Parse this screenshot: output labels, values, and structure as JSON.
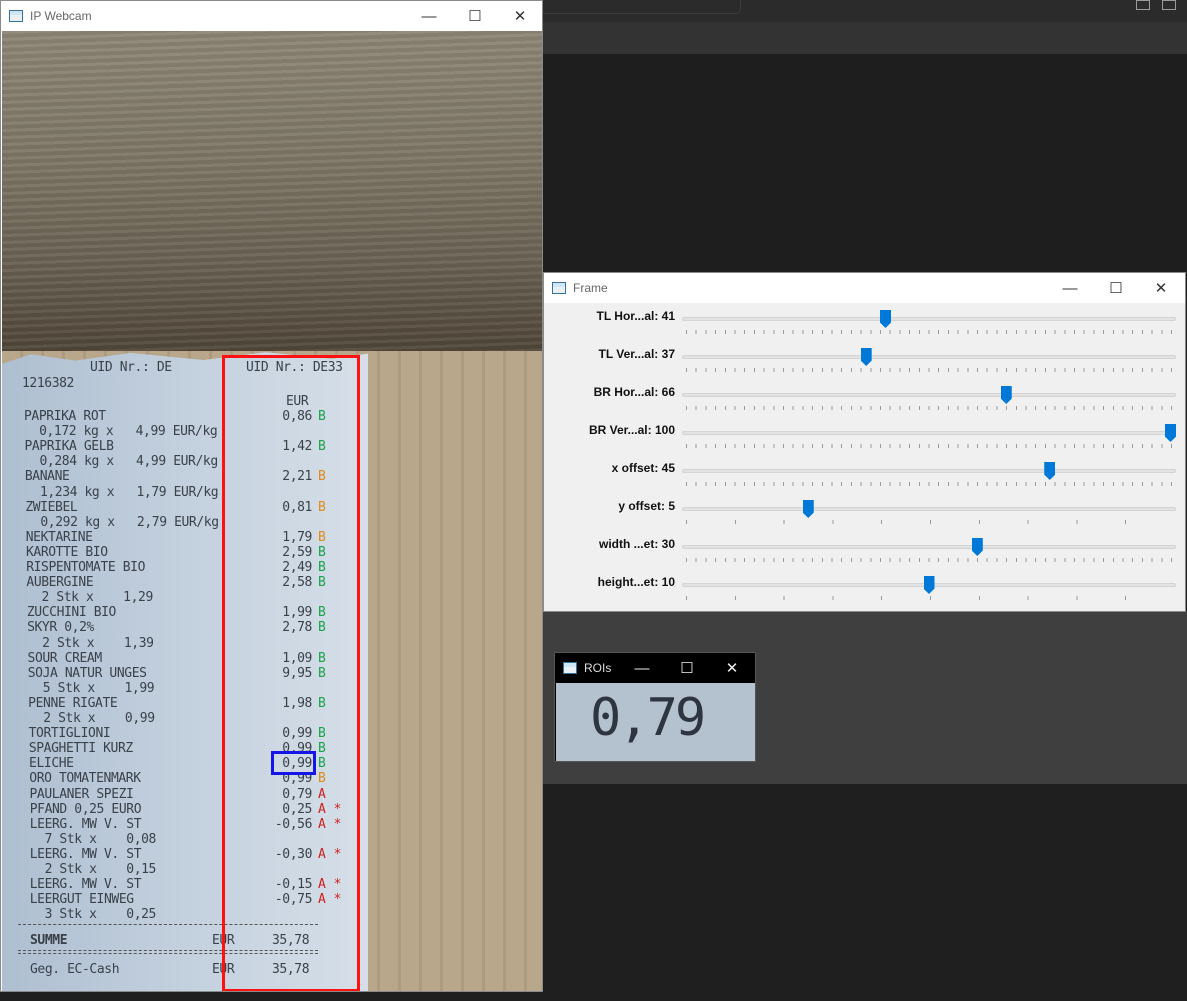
{
  "webcam_window": {
    "title": "IP Webcam",
    "controls": {
      "minimize": "—",
      "maximize": "☐",
      "close": "✕"
    }
  },
  "receipt": {
    "uid_left": "UID Nr.: DE",
    "uid_right": "UID Nr.: DE33",
    "number": "1216382",
    "currency_header": "EUR",
    "lines": [
      {
        "text": "PAPRIKA ROT",
        "value": "0,86",
        "tax": "B"
      },
      {
        "text": "  0,172 kg x   4,99 EUR/kg",
        "value": "",
        "tax": ""
      },
      {
        "text": "PAPRIKA GELB",
        "value": "1,42",
        "tax": "B"
      },
      {
        "text": "  0,284 kg x   4,99 EUR/kg",
        "value": "",
        "tax": ""
      },
      {
        "text": "BANANE",
        "value": "2,21",
        "tax": "B"
      },
      {
        "text": "  1,234 kg x   1,79 EUR/kg",
        "value": "",
        "tax": ""
      },
      {
        "text": "ZWIEBEL",
        "value": "0,81",
        "tax": "B"
      },
      {
        "text": "  0,292 kg x   2,79 EUR/kg",
        "value": "",
        "tax": ""
      },
      {
        "text": "NEKTARINE",
        "value": "1,79",
        "tax": "B"
      },
      {
        "text": "KAROTTE BIO",
        "value": "2,59",
        "tax": "B"
      },
      {
        "text": "RISPENTOMATE BIO",
        "value": "2,49",
        "tax": "B"
      },
      {
        "text": "AUBERGINE",
        "value": "2,58",
        "tax": "B"
      },
      {
        "text": "  2 Stk x    1,29",
        "value": "",
        "tax": ""
      },
      {
        "text": "ZUCCHINI BIO",
        "value": "1,99",
        "tax": "B"
      },
      {
        "text": "SKYR 0,2%",
        "value": "2,78",
        "tax": "B"
      },
      {
        "text": "  2 Stk x    1,39",
        "value": "",
        "tax": ""
      },
      {
        "text": "SOUR CREAM",
        "value": "1,09",
        "tax": "B"
      },
      {
        "text": "SOJA NATUR UNGES",
        "value": "9,95",
        "tax": "B"
      },
      {
        "text": "  5 Stk x    1,99",
        "value": "",
        "tax": ""
      },
      {
        "text": "PENNE RIGATE",
        "value": "1,98",
        "tax": "B"
      },
      {
        "text": "  2 Stk x    0,99",
        "value": "",
        "tax": ""
      },
      {
        "text": "TORTIGLIONI",
        "value": "0,99",
        "tax": "B"
      },
      {
        "text": "SPAGHETTI KURZ",
        "value": "0,99",
        "tax": "B"
      },
      {
        "text": "ELICHE",
        "value": "0,99",
        "tax": "B"
      },
      {
        "text": "ORO TOMATENMARK",
        "value": "0,99",
        "tax": "B"
      },
      {
        "text": "PAULANER SPEZI",
        "value": "0,79",
        "tax": "A"
      },
      {
        "text": "PFAND 0,25 EURO",
        "value": "0,25",
        "tax": "A *"
      },
      {
        "text": "LEERG. MW V. ST",
        "value": "-0,56",
        "tax": "A *"
      },
      {
        "text": "  7 Stk x    0,08",
        "value": "",
        "tax": ""
      },
      {
        "text": "LEERG. MW V. ST",
        "value": "-0,30",
        "tax": "A *"
      },
      {
        "text": "  2 Stk x    0,15",
        "value": "",
        "tax": ""
      },
      {
        "text": "LEERG. MW V. ST",
        "value": "-0,15",
        "tax": "A *"
      },
      {
        "text": "LEERGUT EINWEG",
        "value": "-0,75",
        "tax": "A *"
      },
      {
        "text": "  3 Stk x    0,25",
        "value": "",
        "tax": ""
      }
    ],
    "sum_label": "SUMME",
    "sum_currency": "EUR",
    "sum_value": "35,78",
    "payment_label": "Geg. EC-Cash",
    "payment_currency": "EUR",
    "payment_value": "35,78"
  },
  "frame_window": {
    "title": "Frame",
    "controls": {
      "minimize": "—",
      "maximize": "☐",
      "close": "✕"
    },
    "sliders": [
      {
        "label": "TL Hor...al: 41",
        "value": 41,
        "max": 100,
        "ticks": "fine"
      },
      {
        "label": "TL Ver...al: 37",
        "value": 37,
        "max": 100,
        "ticks": "fine"
      },
      {
        "label": "BR Hor...al: 66",
        "value": 66,
        "max": 100,
        "ticks": "fine"
      },
      {
        "label": "BR Ver...al: 100",
        "value": 100,
        "max": 100,
        "ticks": "fine"
      },
      {
        "label": "x offset: 45",
        "value": 45,
        "max": 60,
        "ticks": "fine"
      },
      {
        "label": "y offset: 5",
        "value": 5,
        "max": 20,
        "ticks": "sparse"
      },
      {
        "label": "width ...et: 30",
        "value": 30,
        "max": 50,
        "ticks": "fine"
      },
      {
        "label": "height...et: 10",
        "value": 10,
        "max": 20,
        "ticks": "sparse"
      }
    ]
  },
  "rois_window": {
    "title": "ROIs",
    "controls": {
      "minimize": "—",
      "maximize": "☐",
      "close": "✕"
    },
    "roi_value": "0,79"
  },
  "colors": {
    "red_roi": "#ff1111",
    "blue_roi": "#1515e8",
    "slider_thumb": "#0078d7",
    "tax_green": "#1aa34a",
    "tax_orange": "#e08a1a",
    "tax_red": "#d02020"
  }
}
